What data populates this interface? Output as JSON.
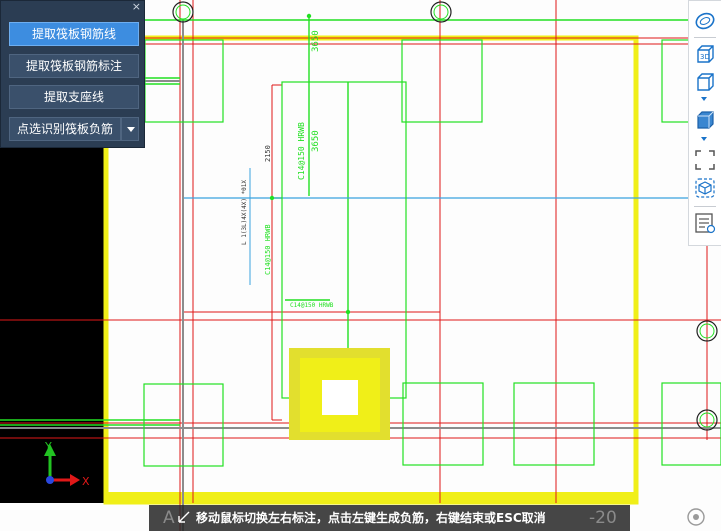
{
  "panel": {
    "close_label": "×",
    "buttons": [
      {
        "label": "提取筏板钢筋线",
        "active": true
      },
      {
        "label": "提取筏板钢筋标注",
        "active": false
      },
      {
        "label": "提取支座线",
        "active": false
      },
      {
        "label": "点选识别筏板负筋",
        "active": false
      }
    ]
  },
  "toolbar": {
    "items": [
      "ellipse-icon",
      "3d-view-icon",
      "cube-icon",
      "cube-filled-icon",
      "fit-screen-icon",
      "box-select-icon",
      "layer-list-icon"
    ]
  },
  "drawing": {
    "labels": {
      "dim_3650_top": "3650",
      "dim_3650_mid": "3650",
      "rebar_c14_150_vert": "C14@150 HRWB",
      "rebar_c14_150_horiz": "C14@150 HRWB",
      "rebar_c14_left": "C14@150 HRWB",
      "dim_2150": "2150",
      "note_vert": "L 1(3L)4X(4X) *01X"
    },
    "axis": {
      "x": "X",
      "y": "Y"
    }
  },
  "status": {
    "message": "移动鼠标切换左右标注，点击左键生成负筋，右键结束或ESC取消",
    "bg_left": "A",
    "bg_right": "-20"
  },
  "colors": {
    "green": "#22e022",
    "red": "#e01818",
    "yellow": "#f0ef18",
    "blue": "#3aa3e0",
    "panel": "#2b3d53",
    "active_button": "#3d8de0"
  }
}
